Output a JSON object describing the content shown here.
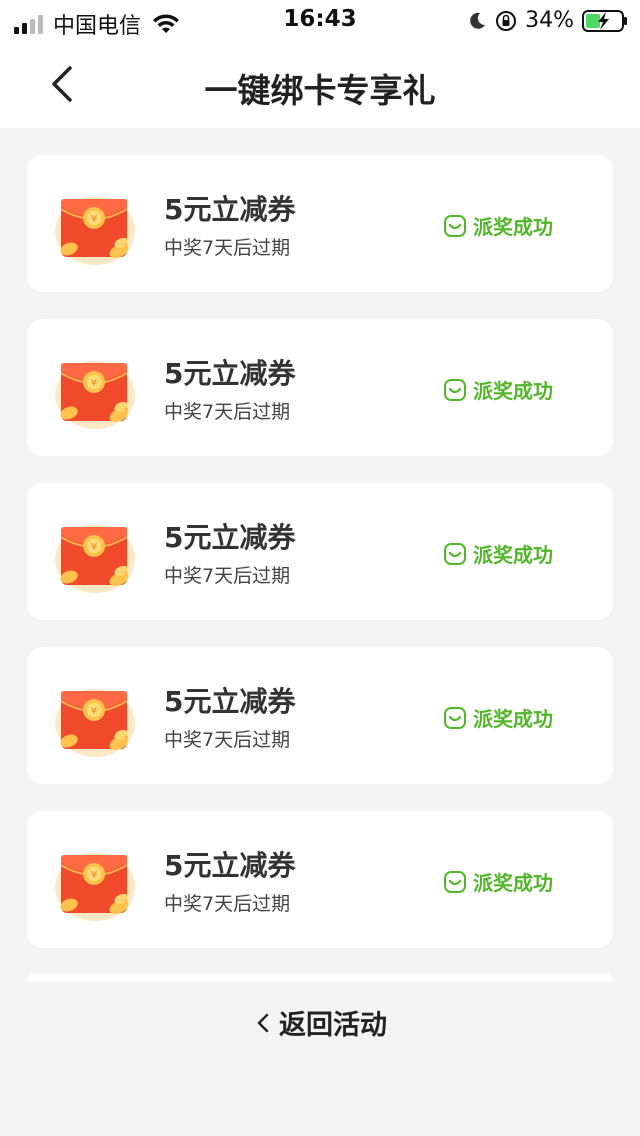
{
  "status_bar": {
    "carrier": "中国电信",
    "time": "16:43",
    "battery_percent": "34%"
  },
  "nav": {
    "title": "一键绑卡专享礼"
  },
  "rewards": [
    {
      "title": "5元立减券",
      "subtitle": "中奖7天后过期",
      "status": "派奖成功"
    },
    {
      "title": "5元立减券",
      "subtitle": "中奖7天后过期",
      "status": "派奖成功"
    },
    {
      "title": "5元立减券",
      "subtitle": "中奖7天后过期",
      "status": "派奖成功"
    },
    {
      "title": "5元立减券",
      "subtitle": "中奖7天后过期",
      "status": "派奖成功"
    },
    {
      "title": "5元立减券",
      "subtitle": "中奖7天后过期",
      "status": "派奖成功"
    }
  ],
  "footer": {
    "return_label": "返回活动"
  },
  "colors": {
    "accent_green": "#52b52a",
    "envelope_red": "#f04a2c",
    "background": "#f4f4f4"
  }
}
